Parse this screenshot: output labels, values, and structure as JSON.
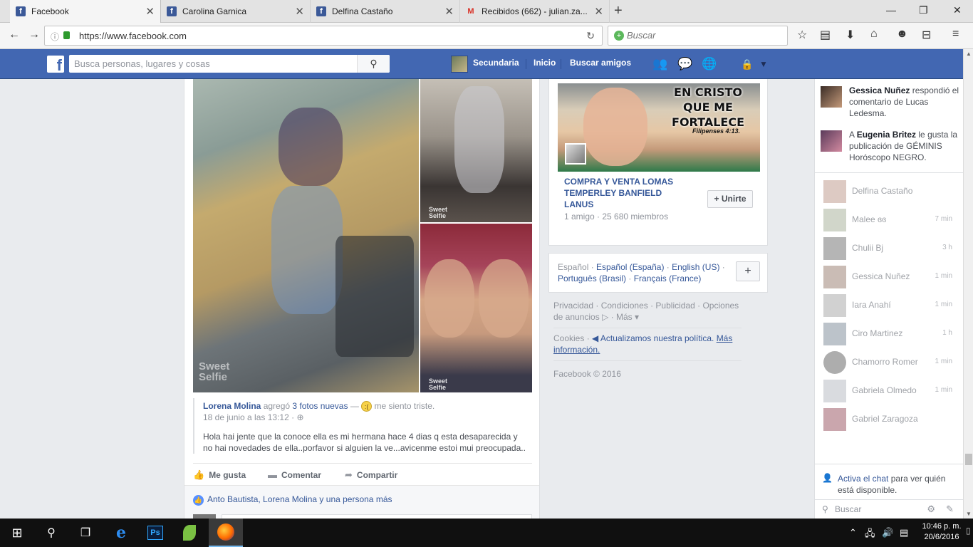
{
  "browser": {
    "tabs": [
      {
        "label": "Facebook",
        "icon": "facebook-icon"
      },
      {
        "label": "Carolina Garnica",
        "icon": "facebook-icon"
      },
      {
        "label": "Delfina Castaño",
        "icon": "facebook-icon"
      },
      {
        "label": "Recibidos (662) - julian.za...",
        "icon": "gmail-icon"
      }
    ],
    "url": "https://www.facebook.com",
    "search_placeholder": "Buscar"
  },
  "fb_header": {
    "search_placeholder": "Busca personas, lugares y cosas",
    "profile_name": "Secundaria",
    "home": "Inicio",
    "find_friends": "Buscar amigos"
  },
  "post": {
    "author": "Lorena Molina",
    "action": "agregó",
    "photos_link": "3 fotos nuevas",
    "dash": "—",
    "feeling": "me siento triste.",
    "date": "18 de junio a las 13:12 ·",
    "text_line1": "Hola hai jente que la conoce ella es mi hermana hace 4 dias q esta desaparecida y",
    "text_line2": "no hai novedades de ella..porfavor si alguien la ve...avicenme estoi mui preocupada..",
    "watermark_big": "Sweet Selfie",
    "watermark_small": "Sweet Selfie",
    "actions": {
      "like": "Me gusta",
      "comment": "Comentar",
      "share": "Compartir"
    },
    "likes_text": "Anto Bautista, Lorena Molina y una persona más"
  },
  "group": {
    "caption_line1": "EN CRISTO",
    "caption_line2": "QUE ME",
    "caption_line3": "FORTALECE",
    "verse": "Filipenses 4:13.",
    "name": "COMPRA Y VENTA LOMAS TEMPERLEY BANFIELD LANUS",
    "meta": "1 amigo · 25 680 miembros",
    "join": "+ Unirte"
  },
  "languages": {
    "current": "Español",
    "opt1": "Español (España)",
    "opt2": "English (US)",
    "opt3": "Português (Brasil)",
    "opt4": "Français (France)",
    "add": "+"
  },
  "footer": {
    "privacy": "Privacidad",
    "terms": "Condiciones",
    "advertising": "Publicidad",
    "ad_choices": "Opciones de anuncios",
    "more": "Más",
    "cookies": "Cookies",
    "policy_update": "◀ Actualizamos nuestra política.",
    "more_info": "Más información.",
    "copyright": "Facebook © 2016"
  },
  "ticker": [
    {
      "name": "Gessica Nuñez",
      "pre": "",
      "text": "respondió el comentario de Lucas Ledesma."
    },
    {
      "name": "Eugenia Britez",
      "pre": "A",
      "text": "le gusta la publicación de GÉMINIS Horóscopo NEGRO."
    }
  ],
  "chat": {
    "contacts": [
      {
        "name": "Delfina Castaño",
        "time": ""
      },
      {
        "name": "Malee ɞɞ",
        "time": "7 min"
      },
      {
        "name": "Chulii Bj",
        "time": "3 h"
      },
      {
        "name": "Gessica Nuñez",
        "time": "1 min"
      },
      {
        "name": "Iara Anahí",
        "time": "1 min"
      },
      {
        "name": "Ciro Martinez",
        "time": "1 h"
      },
      {
        "name": "Chamorro Romer",
        "time": "1 min"
      },
      {
        "name": "Gabriela Olmedo",
        "time": "1 min"
      },
      {
        "name": "Gabriel Zaragoza",
        "time": ""
      }
    ],
    "activate_link": "Activa el chat",
    "activate_rest": "para ver quién está disponible.",
    "search_placeholder": "Buscar"
  },
  "taskbar": {
    "time": "10:46 p. m.",
    "date": "20/6/2016"
  },
  "colors": {
    "fb_blue": "#4267b2",
    "link": "#365899"
  }
}
